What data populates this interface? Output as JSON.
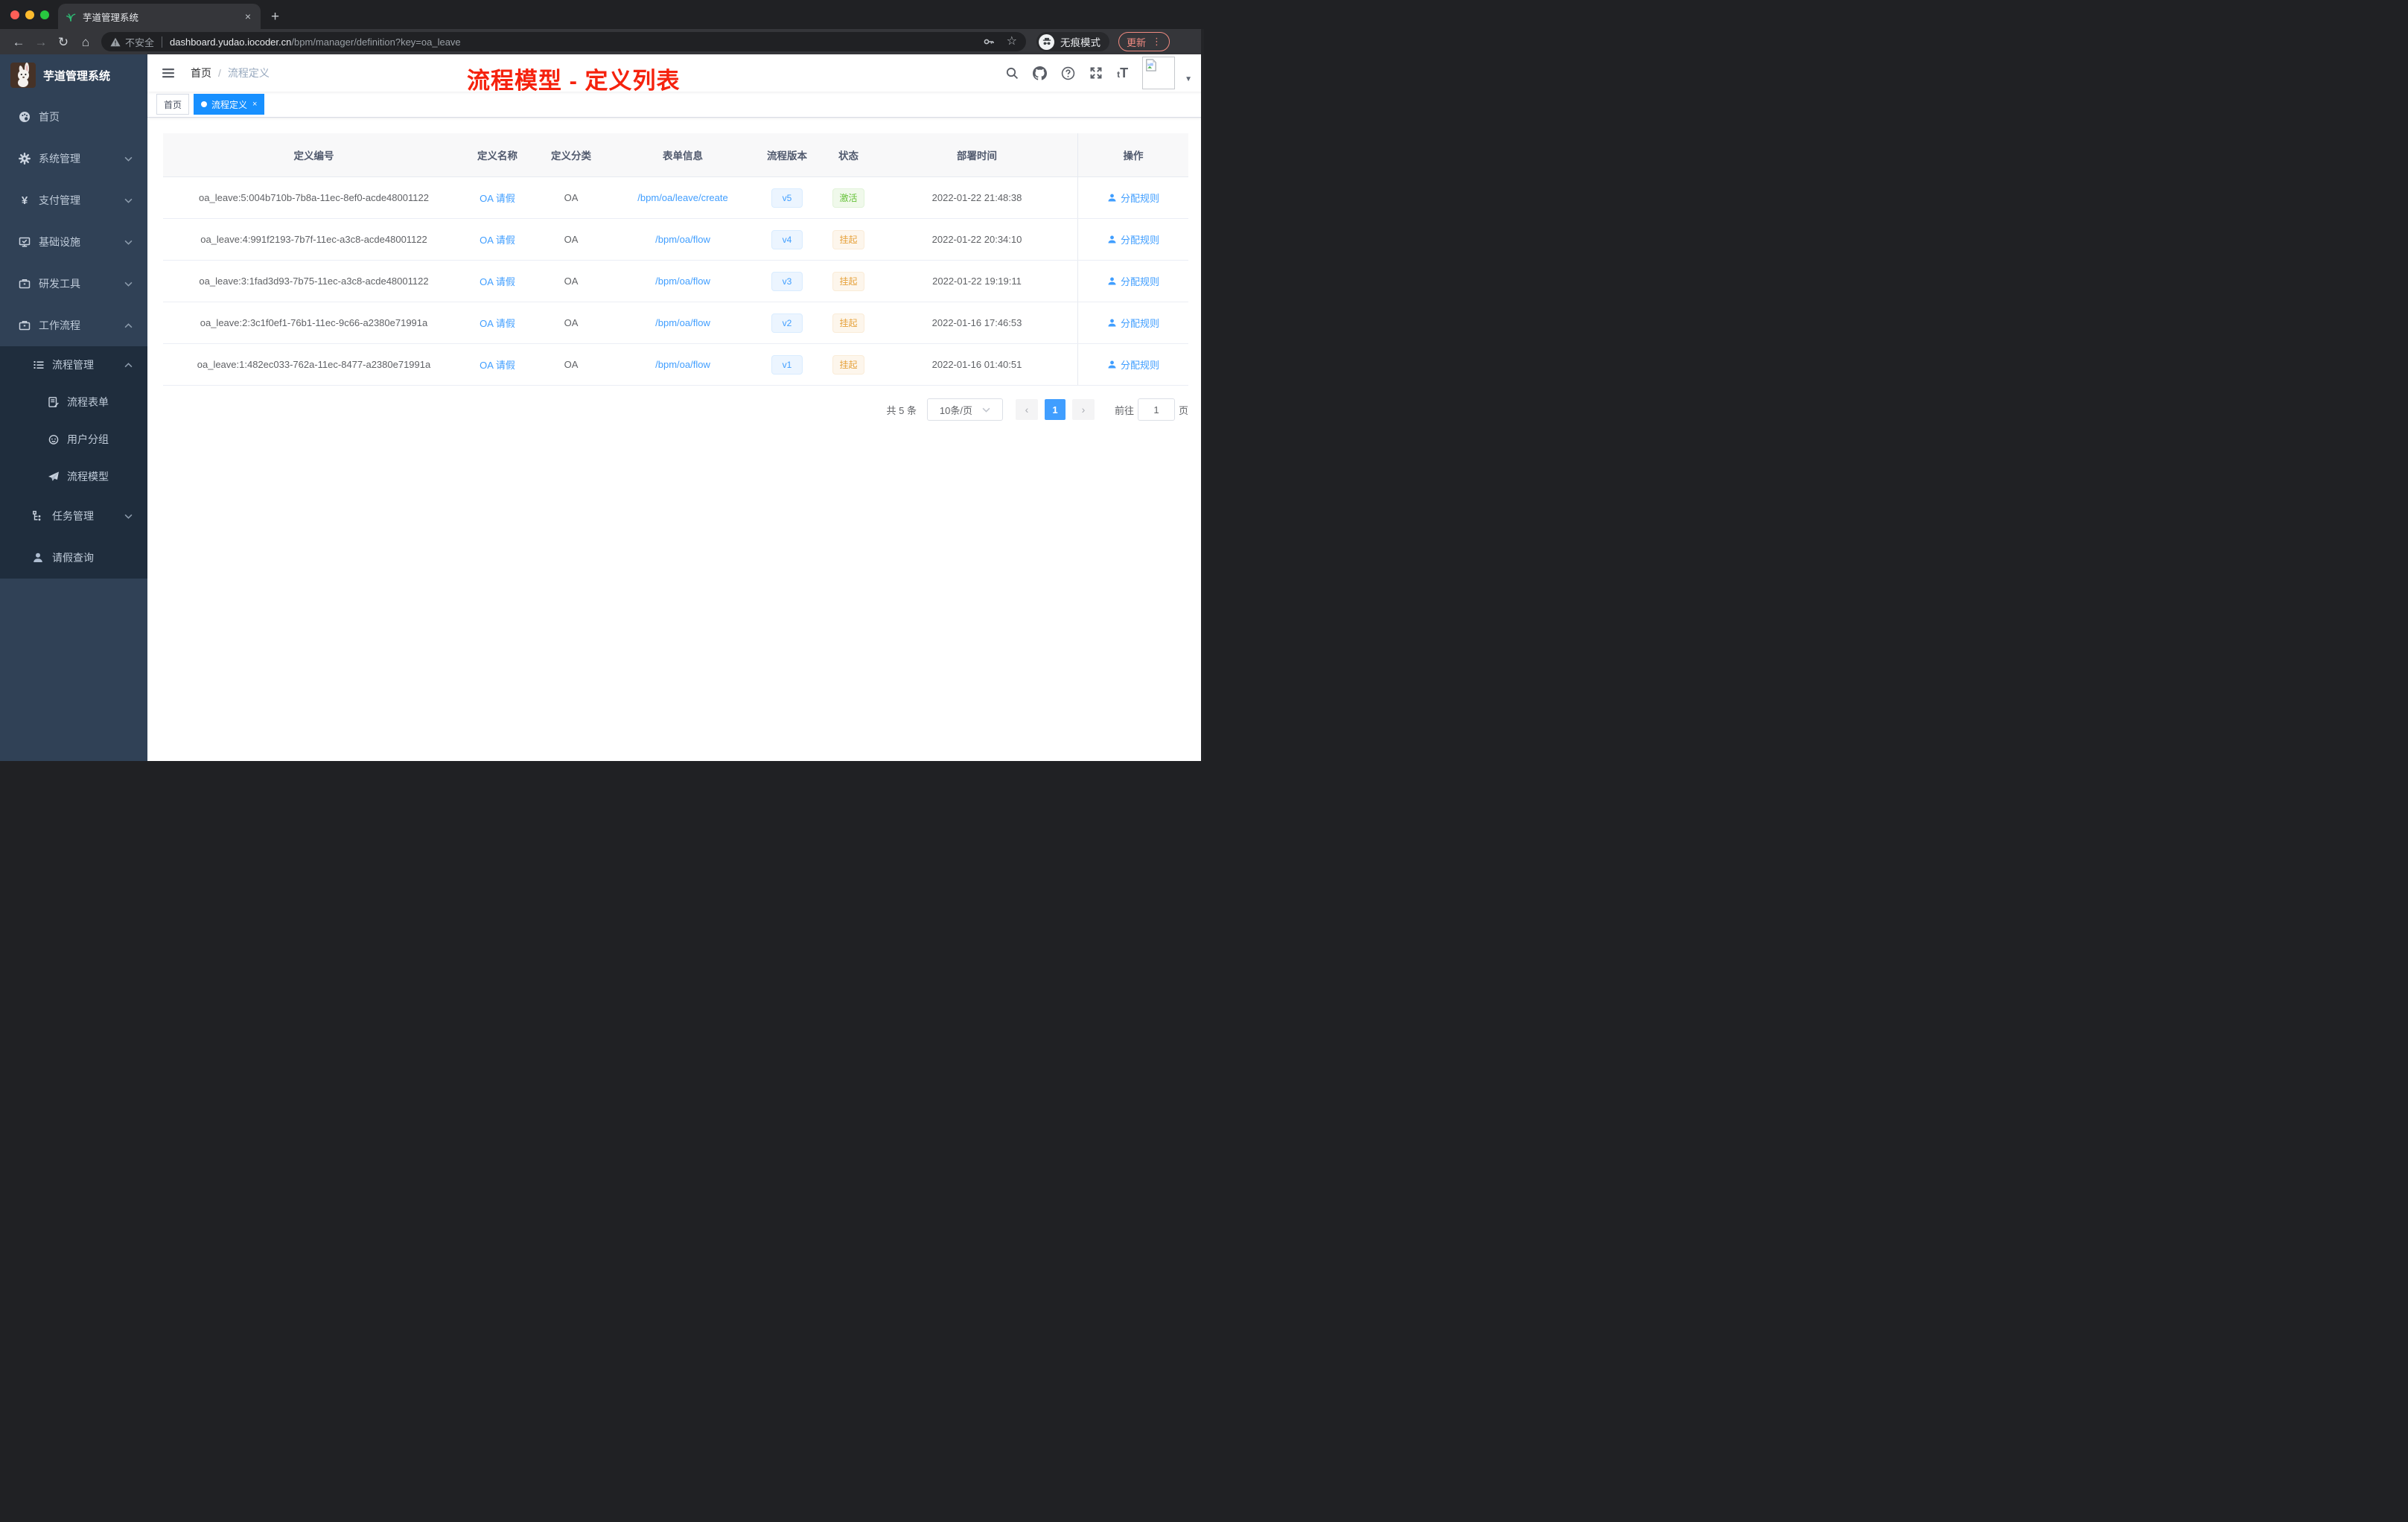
{
  "colors": {
    "accent_link": "#409eff",
    "tag_active": "#1890ff",
    "status_success": "#67c23a",
    "status_warning": "#e6a23c",
    "annotation_red": "#f5220d",
    "sidebar_bg": "#304156",
    "submenu_bg": "#1f2d3d"
  },
  "browser": {
    "tab_title": "芋道管理系统",
    "tab_close": "×",
    "new_tab": "+",
    "back": "←",
    "forward": "→",
    "reload": "↻",
    "home": "⌂",
    "security_label": "不安全",
    "url_host": "dashboard.yudao.iocoder.cn",
    "url_path": "/bpm/manager/definition?key=oa_leave",
    "star": "☆",
    "incognito_label": "无痕模式",
    "update_label": "更新",
    "menu_dots": "⋮"
  },
  "sidebar": {
    "app_title": "芋道管理系统",
    "home": "首页",
    "system": "系统管理",
    "payment": "支付管理",
    "infrastructure": "基础设施",
    "devtools": "研发工具",
    "workflow": "工作流程",
    "process_management": "流程管理",
    "process_form": "流程表单",
    "user_group": "用户分组",
    "process_model": "流程模型",
    "task_management": "任务管理",
    "leave_query": "请假查询",
    "yen_icon": "¥"
  },
  "navbar": {
    "breadcrumb_home": "首页",
    "breadcrumb_sep": "/",
    "breadcrumb_current": "流程定义",
    "fontsize_icon": "tT",
    "avatar_caret": "▼"
  },
  "annotation": {
    "title": "流程模型 - 定义列表"
  },
  "tags": {
    "home": "首页",
    "active": "流程定义",
    "close": "×"
  },
  "table": {
    "columns": [
      "定义编号",
      "定义名称",
      "定义分类",
      "表单信息",
      "流程版本",
      "状态",
      "部署时间",
      "操作"
    ],
    "rows": [
      {
        "id": "oa_leave:5:004b710b-7b8a-11ec-8ef0-acde48001122",
        "name": "OA 请假",
        "category": "OA",
        "form": "/bpm/oa/leave/create",
        "version": "v5",
        "status": "激活",
        "deploy_time": "2022-01-22 21:48:38",
        "action": "分配规则"
      },
      {
        "id": "oa_leave:4:991f2193-7b7f-11ec-a3c8-acde48001122",
        "name": "OA 请假",
        "category": "OA",
        "form": "/bpm/oa/flow",
        "version": "v4",
        "status": "挂起",
        "deploy_time": "2022-01-22 20:34:10",
        "action": "分配规则"
      },
      {
        "id": "oa_leave:3:1fad3d93-7b75-11ec-a3c8-acde48001122",
        "name": "OA 请假",
        "category": "OA",
        "form": "/bpm/oa/flow",
        "version": "v3",
        "status": "挂起",
        "deploy_time": "2022-01-22 19:19:11",
        "action": "分配规则"
      },
      {
        "id": "oa_leave:2:3c1f0ef1-76b1-11ec-9c66-a2380e71991a",
        "name": "OA 请假",
        "category": "OA",
        "form": "/bpm/oa/flow",
        "version": "v2",
        "status": "挂起",
        "deploy_time": "2022-01-16 17:46:53",
        "action": "分配规则"
      },
      {
        "id": "oa_leave:1:482ec033-762a-11ec-8477-a2380e71991a",
        "name": "OA 请假",
        "category": "OA",
        "form": "/bpm/oa/flow",
        "version": "v1",
        "status": "挂起",
        "deploy_time": "2022-01-16 01:40:51",
        "action": "分配规则"
      }
    ]
  },
  "pagination": {
    "total": "共 5 条",
    "page_size": "10条/页",
    "prev": "‹",
    "page": "1",
    "next": "›",
    "goto_label": "前往",
    "goto_value": "1",
    "unit": "页"
  }
}
